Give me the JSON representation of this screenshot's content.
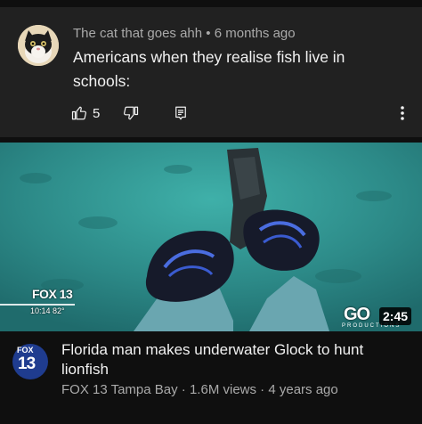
{
  "comment": {
    "author": "The cat that goes ahh",
    "separator": "•",
    "age": "6 months ago",
    "text": "Americans when they realise fish live in schools:",
    "likes": "5",
    "icons": {
      "like": "thumbs-up-icon",
      "dislike": "thumbs-down-icon",
      "reply": "reply-icon",
      "more": "more-vert-icon"
    }
  },
  "video": {
    "thumbnail": {
      "station_logo": "FOX 13",
      "time_temp": "10:14  82°",
      "watermark": "GO",
      "watermark_sub": "PRODUCTIONS",
      "duration": "2:45"
    },
    "channel_logo_top": "FOX",
    "channel_logo_num": "13",
    "title": "Florida man makes underwater Glock to hunt lionfish",
    "channel": "FOX 13 Tampa Bay",
    "views": "1.6M views",
    "age": "4 years ago",
    "meta_separator": "·"
  },
  "colors": {
    "background": "#0f0f0f",
    "card": "#212121",
    "text_primary": "#f1f1f1",
    "text_secondary": "#aaaaaa",
    "water": "#2f8f8c"
  }
}
